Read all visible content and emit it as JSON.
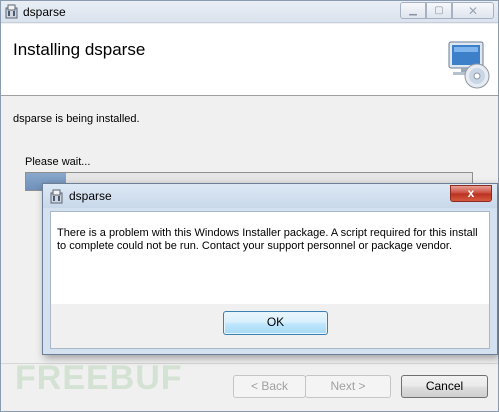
{
  "window": {
    "title": "dsparse",
    "controls": {
      "minimize_icon": "minimize-icon",
      "maximize_icon": "maximize-icon",
      "close_icon": "close-icon"
    }
  },
  "banner": {
    "title": "Installing dsparse",
    "icon": "installer-cd-computer-icon"
  },
  "status": {
    "message": "dsparse is being installed.",
    "wait_label": "Please wait...",
    "progress": 0.09
  },
  "footer": {
    "back_label": "< Back",
    "next_label": "Next >",
    "cancel_label": "Cancel"
  },
  "dialog": {
    "title": "dsparse",
    "close_symbol": "x",
    "message": "There is a problem with this Windows Installer package. A script required for this install to complete could not be run. Contact your support personnel or package vendor.",
    "ok_label": "OK"
  },
  "watermark": {
    "text": "FREEBUF"
  }
}
